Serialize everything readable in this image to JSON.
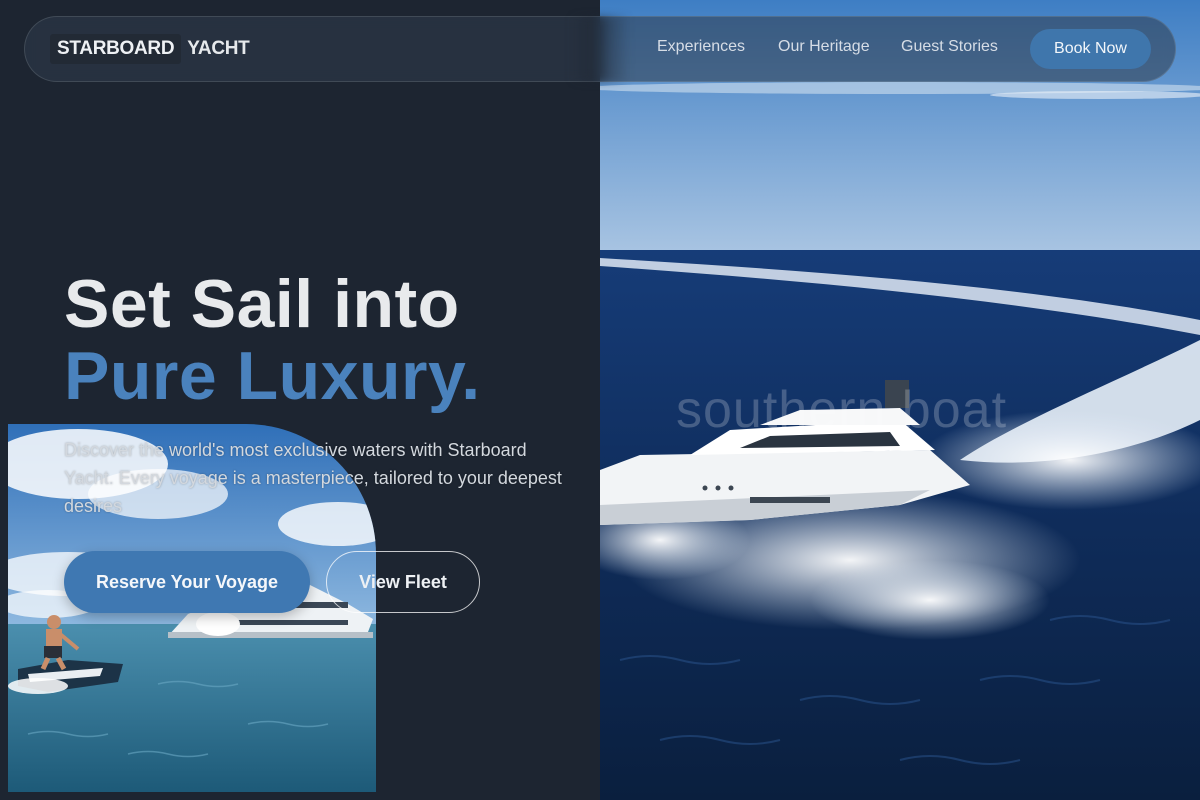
{
  "brand": {
    "box_text": "STARBOARD",
    "rest_text": "YACHT"
  },
  "nav": {
    "links": [
      "Experiences",
      "Our Heritage",
      "Guest Stories"
    ],
    "cta": "Book Now"
  },
  "hero": {
    "headline_line1": "Set Sail into",
    "headline_line2": "Pure Luxury.",
    "description": "Discover the world's most exclusive waters with Starboard Yacht. Every voyage is a masterpiece, tailored to your deepest desires",
    "primary_button": "Reserve Your Voyage",
    "secondary_button": "View Fleet"
  },
  "colors": {
    "background": "#1d2531",
    "accent": "#3f78b2",
    "headline_accent": "#4a82bd"
  }
}
